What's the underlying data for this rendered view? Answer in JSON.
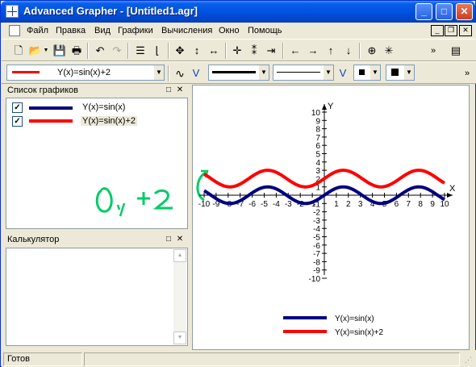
{
  "window": {
    "title": "Advanced Grapher - [Untitled1.agr]"
  },
  "menu": [
    "Файл",
    "Правка",
    "Вид",
    "Графики",
    "Вычисления",
    "Окно",
    "Помощь"
  ],
  "toolbar2": {
    "function_combo_value": "Y(x)=sin(x)+2",
    "line_color": "#ff0000"
  },
  "graphs_panel": {
    "title": "Список графиков",
    "items": [
      {
        "label": "Y(x)=sin(x)",
        "checked": true,
        "color": "#000080"
      },
      {
        "label": "Y(x)=sin(x)+2",
        "checked": true,
        "color": "#ff0000"
      }
    ]
  },
  "calc_panel": {
    "title": "Калькулятор"
  },
  "annotation": {
    "text": "Oy +2",
    "color": "#00cc66"
  },
  "chart_data": {
    "type": "line",
    "xlabel": "X",
    "ylabel": "Y",
    "xlim": [
      -10,
      10
    ],
    "ylim": [
      -10,
      10
    ],
    "x_ticks": [
      "-10",
      "-9",
      "-8",
      "-7",
      "-6",
      "-5",
      "-4",
      "-3",
      "-2",
      "-1",
      "0",
      "1",
      "2",
      "3",
      "4",
      "5",
      "6",
      "7",
      "8",
      "9",
      "10"
    ],
    "y_ticks": [
      "10",
      "9",
      "8",
      "7",
      "6",
      "5",
      "4",
      "3",
      "2",
      "1",
      "-1",
      "-2",
      "-3",
      "-4",
      "-5",
      "-6",
      "-7",
      "-8",
      "-9",
      "-10"
    ],
    "series": [
      {
        "name": "Y(x)=sin(x)",
        "formula": "sin(x)",
        "color": "#000080"
      },
      {
        "name": "Y(x)=sin(x)+2",
        "formula": "sin(x)+2",
        "color": "#ff0000"
      }
    ],
    "legend": "bottom-right"
  },
  "status": {
    "text": "Готов"
  }
}
